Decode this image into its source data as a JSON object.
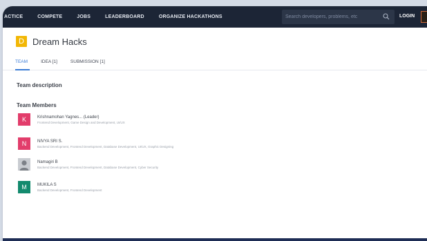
{
  "nav": {
    "items": [
      "ACTICE",
      "COMPETE",
      "JOBS",
      "LEADERBOARD",
      "ORGANIZE HACKATHONS"
    ],
    "search_placeholder": "Search developers, problems, etc",
    "login": "LOGIN"
  },
  "team": {
    "initial": "D",
    "name": "Dream Hacks",
    "avatar_color": "#f2b705"
  },
  "tabs": [
    {
      "label": "TEAM",
      "active": true
    },
    {
      "label": "IDEA [1]",
      "active": false
    },
    {
      "label": "SUBMISSION [1]",
      "active": false
    }
  ],
  "sections": {
    "description_title": "Team description",
    "members_title": "Team Members"
  },
  "members": [
    {
      "initial": "K",
      "color": "#e23d6b",
      "name": "Krishnamohan Yagnes... (Leader)",
      "skills": "Frontend Development, Game Design and Development, UI/UX"
    },
    {
      "initial": "N",
      "color": "#e23d6b",
      "name": "NIVYA SRI S.",
      "skills": "Backend Development, Frontend Development, Database Development, UI/UX, Graphic Designing"
    },
    {
      "initial": "",
      "color": "#c9ccd1",
      "name": "Namagiri B",
      "skills": "Backend Development, Frontend Development, Database Development, Cyber Security"
    },
    {
      "initial": "M",
      "color": "#138a6e",
      "name": "MUKILA S",
      "skills": "Backend Development, Frontend Development"
    }
  ],
  "colors": {
    "nav_bg": "#1c2536",
    "accent": "#3a7bd5",
    "page_bg": "#d4dbe6"
  }
}
